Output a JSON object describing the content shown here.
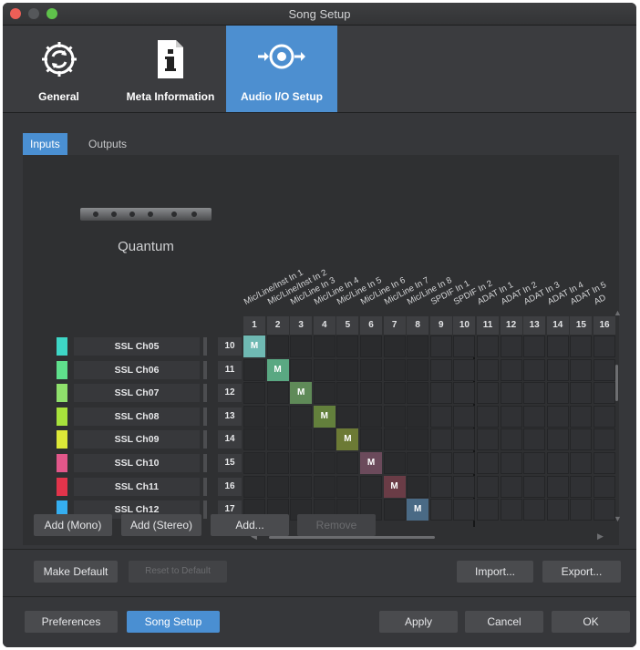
{
  "window": {
    "title": "Song Setup"
  },
  "toolbar": {
    "general": "General",
    "meta": "Meta Information",
    "audio": "Audio I/O Setup"
  },
  "tabs": {
    "inputs": "Inputs",
    "outputs": "Outputs"
  },
  "device": {
    "name": "Quantum"
  },
  "columns": [
    {
      "num": "1",
      "label": "Mic/Line/Inst In 1"
    },
    {
      "num": "2",
      "label": "Mic/Line/Inst In 2"
    },
    {
      "num": "3",
      "label": "Mic/Line In 3"
    },
    {
      "num": "4",
      "label": "Mic/Line In 4"
    },
    {
      "num": "5",
      "label": "Mic/Line In 5"
    },
    {
      "num": "6",
      "label": "Mic/Line In 6"
    },
    {
      "num": "7",
      "label": "Mic/Line In 7"
    },
    {
      "num": "8",
      "label": "Mic/Line In 8"
    },
    {
      "num": "9",
      "label": "SPDIF In 1"
    },
    {
      "num": "10",
      "label": "SPDIF In 2"
    },
    {
      "num": "11",
      "label": "ADAT In 1"
    },
    {
      "num": "12",
      "label": "ADAT In 2"
    },
    {
      "num": "13",
      "label": "ADAT In 3"
    },
    {
      "num": "14",
      "label": "ADAT In 4"
    },
    {
      "num": "15",
      "label": "ADAT In 5"
    },
    {
      "num": "16",
      "label": "AD"
    }
  ],
  "rows": [
    {
      "name": "SSL Ch05",
      "num": "10",
      "color": "#3ed6c6",
      "col": 1,
      "mark": "M",
      "markColor": "#6fb9b3"
    },
    {
      "name": "SSL Ch06",
      "num": "11",
      "color": "#5fe08c",
      "col": 2,
      "mark": "M",
      "markColor": "#5aa882"
    },
    {
      "name": "SSL Ch07",
      "num": "12",
      "color": "#8fe06c",
      "col": 3,
      "mark": "M",
      "markColor": "#5f8a58"
    },
    {
      "name": "SSL Ch08",
      "num": "13",
      "color": "#a8e23c",
      "col": 4,
      "mark": "M",
      "markColor": "#63803c"
    },
    {
      "name": "SSL Ch09",
      "num": "14",
      "color": "#dde838",
      "col": 5,
      "mark": "M",
      "markColor": "#6c7a35"
    },
    {
      "name": "SSL Ch10",
      "num": "15",
      "color": "#e2578a",
      "col": 6,
      "mark": "M",
      "markColor": "#6b4a5b"
    },
    {
      "name": "SSL Ch11",
      "num": "16",
      "color": "#e2344b",
      "col": 7,
      "mark": "M",
      "markColor": "#6a3c46"
    },
    {
      "name": "SSL Ch12",
      "num": "17",
      "color": "#35aef0",
      "col": 8,
      "mark": "M",
      "markColor": "#4a6a85"
    }
  ],
  "buttons": {
    "add_mono": "Add (Mono)",
    "add_stereo": "Add (Stereo)",
    "add": "Add...",
    "remove": "Remove",
    "make_default": "Make Default",
    "reset_default": "Reset to Default",
    "import": "Import...",
    "export": "Export...",
    "preferences": "Preferences",
    "song_setup": "Song Setup",
    "apply": "Apply",
    "cancel": "Cancel",
    "ok": "OK"
  },
  "icons": {
    "general": "gear-sync-icon",
    "meta": "info-document-icon",
    "audio": "speaker-io-icon"
  }
}
